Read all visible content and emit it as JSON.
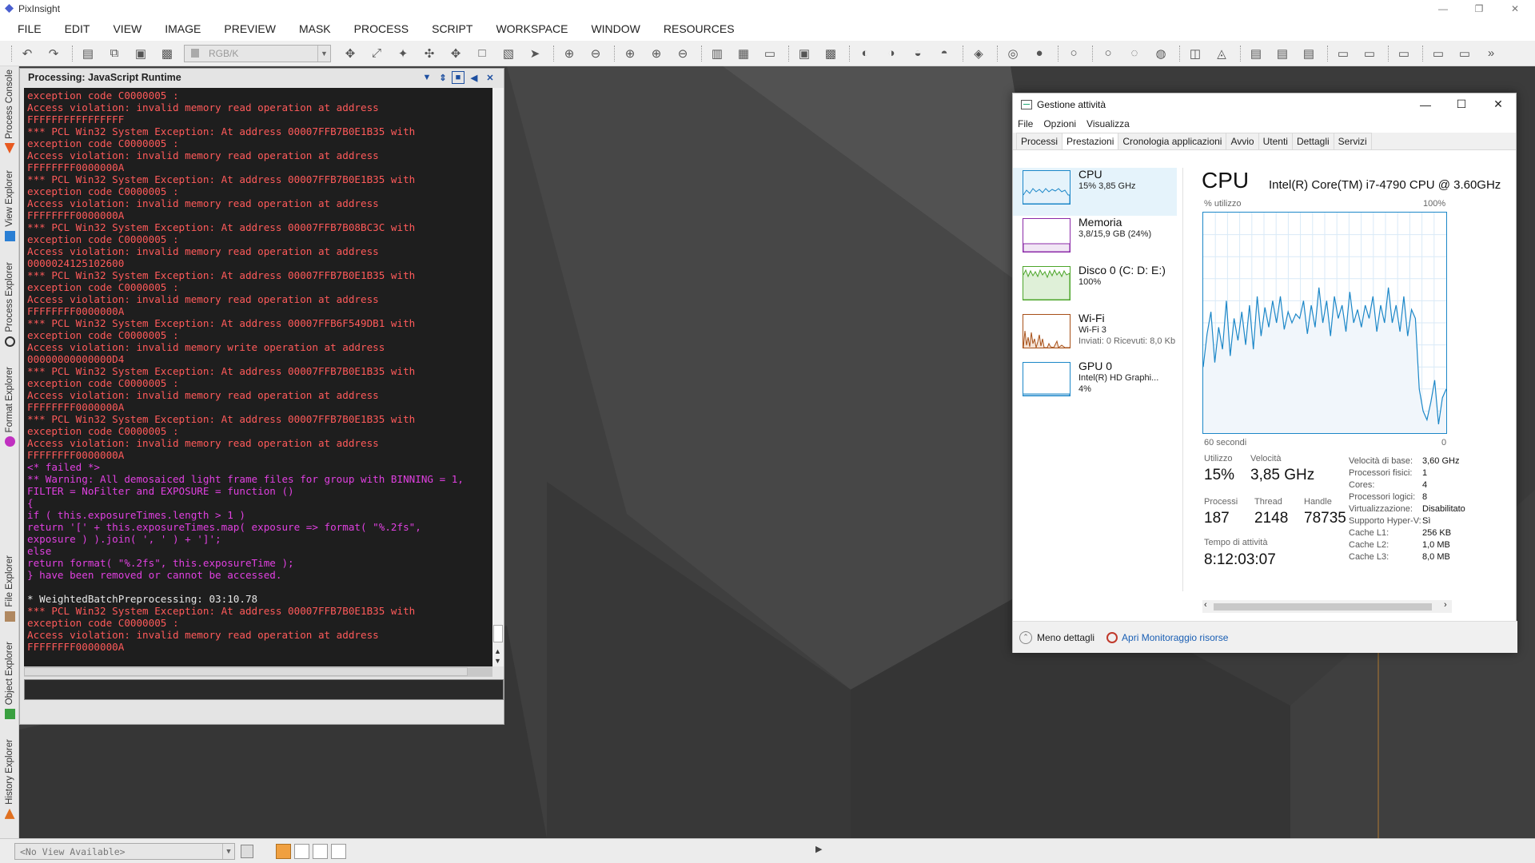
{
  "app": {
    "title": "PixInsight"
  },
  "menu": [
    "FILE",
    "EDIT",
    "VIEW",
    "IMAGE",
    "PREVIEW",
    "MASK",
    "PROCESS",
    "SCRIPT",
    "WORKSPACE",
    "WINDOW",
    "RESOURCES"
  ],
  "toolbar": {
    "color_space": "RGB/K"
  },
  "sidebar_tabs": [
    "Process Console",
    "View Explorer",
    "Process Explorer",
    "Format Explorer",
    "File Explorer",
    "Object Explorer",
    "History Explorer"
  ],
  "console": {
    "title": "Processing: JavaScript Runtime",
    "lines": [
      {
        "t": "exception code C0000005 :",
        "c": "#ff5a5a"
      },
      {
        "t": "Access violation: invalid memory read operation at address",
        "c": "#ff5a5a"
      },
      {
        "t": "FFFFFFFFFFFFFFFF",
        "c": "#ff5a5a"
      },
      {
        "t": "*** PCL Win32 System Exception: At address 00007FFB7B0E1B35 with",
        "c": "#ff5a5a"
      },
      {
        "t": "exception code C0000005 :",
        "c": "#ff5a5a"
      },
      {
        "t": "Access violation: invalid memory read operation at address",
        "c": "#ff5a5a"
      },
      {
        "t": "FFFFFFFF0000000A",
        "c": "#ff5a5a"
      },
      {
        "t": "*** PCL Win32 System Exception: At address 00007FFB7B0E1B35 with",
        "c": "#ff5a5a"
      },
      {
        "t": "exception code C0000005 :",
        "c": "#ff5a5a"
      },
      {
        "t": "Access violation: invalid memory read operation at address",
        "c": "#ff5a5a"
      },
      {
        "t": "FFFFFFFF0000000A",
        "c": "#ff5a5a"
      },
      {
        "t": "*** PCL Win32 System Exception: At address 00007FFB7B08BC3C with",
        "c": "#ff5a5a"
      },
      {
        "t": "exception code C0000005 :",
        "c": "#ff5a5a"
      },
      {
        "t": "Access violation: invalid memory read operation at address",
        "c": "#ff5a5a"
      },
      {
        "t": "0000024125102600",
        "c": "#ff5a5a"
      },
      {
        "t": "*** PCL Win32 System Exception: At address 00007FFB7B0E1B35 with",
        "c": "#ff5a5a"
      },
      {
        "t": "exception code C0000005 :",
        "c": "#ff5a5a"
      },
      {
        "t": "Access violation: invalid memory read operation at address",
        "c": "#ff5a5a"
      },
      {
        "t": "FFFFFFFF0000000A",
        "c": "#ff5a5a"
      },
      {
        "t": "*** PCL Win32 System Exception: At address 00007FFB6F549DB1 with",
        "c": "#ff5a5a"
      },
      {
        "t": "exception code C0000005 :",
        "c": "#ff5a5a"
      },
      {
        "t": "Access violation: invalid memory write operation at address",
        "c": "#ff5a5a"
      },
      {
        "t": "00000000000000D4",
        "c": "#ff5a5a"
      },
      {
        "t": "*** PCL Win32 System Exception: At address 00007FFB7B0E1B35 with",
        "c": "#ff5a5a"
      },
      {
        "t": "exception code C0000005 :",
        "c": "#ff5a5a"
      },
      {
        "t": "Access violation: invalid memory read operation at address",
        "c": "#ff5a5a"
      },
      {
        "t": "FFFFFFFF0000000A",
        "c": "#ff5a5a"
      },
      {
        "t": "*** PCL Win32 System Exception: At address 00007FFB7B0E1B35 with",
        "c": "#ff5a5a"
      },
      {
        "t": "exception code C0000005 :",
        "c": "#ff5a5a"
      },
      {
        "t": "Access violation: invalid memory read operation at address",
        "c": "#ff5a5a"
      },
      {
        "t": "FFFFFFFF0000000A",
        "c": "#ff5a5a"
      },
      {
        "t": "<* failed *>",
        "c": "#e040e0"
      },
      {
        "t": "** Warning: All demosaiced light frame files for group with BINNING = 1,",
        "c": "#e040e0"
      },
      {
        "t": "FILTER = NoFilter and EXPOSURE = function ()",
        "c": "#e040e0"
      },
      {
        "t": "{",
        "c": "#e040e0"
      },
      {
        "t": "if ( this.exposureTimes.length > 1 )",
        "c": "#e040e0"
      },
      {
        "t": "return '[' + this.exposureTimes.map( exposure => format( \"%.2fs\",",
        "c": "#e040e0"
      },
      {
        "t": "exposure ) ).join( ', ' ) + ']';",
        "c": "#e040e0"
      },
      {
        "t": "else",
        "c": "#e040e0"
      },
      {
        "t": "return format( \"%.2fs\", this.exposureTime );",
        "c": "#e040e0"
      },
      {
        "t": "} have been removed or cannot be accessed.",
        "c": "#e040e0"
      },
      {
        "t": "",
        "c": "#e0e0e0"
      },
      {
        "t": "* WeightedBatchPreprocessing: 03:10.78",
        "c": "#e8e8e8"
      },
      {
        "t": "*** PCL Win32 System Exception: At address 00007FFB7B0E1B35 with",
        "c": "#ff5a5a"
      },
      {
        "t": "exception code C0000005 :",
        "c": "#ff5a5a"
      },
      {
        "t": "Access violation: invalid memory read operation at address",
        "c": "#ff5a5a"
      },
      {
        "t": "FFFFFFFF0000000A",
        "c": "#ff5a5a"
      }
    ]
  },
  "taskmanager": {
    "title": "Gestione attività",
    "menu": [
      "File",
      "Opzioni",
      "Visualizza"
    ],
    "tabs": [
      "Processi",
      "Prestazioni",
      "Cronologia applicazioni",
      "Avvio",
      "Utenti",
      "Dettagli",
      "Servizi"
    ],
    "active_tab": "Prestazioni",
    "resources": [
      {
        "name": "CPU",
        "sub1": "15% 3,85 GHz",
        "sub2": "",
        "color": "#1c87c8"
      },
      {
        "name": "Memoria",
        "sub1": "3,8/15,9 GB (24%)",
        "sub2": "",
        "color": "#8b2aa8"
      },
      {
        "name": "Disco 0 (C: D: E:)",
        "sub1": "100%",
        "sub2": "",
        "color": "#4ca52a"
      },
      {
        "name": "Wi-Fi",
        "sub1": "Wi-Fi 3",
        "sub2": "Inviati: 0 Ricevuti: 8,0 Kb",
        "color": "#a75018"
      },
      {
        "name": "GPU 0",
        "sub1": "Intel(R) HD Graphi...",
        "sub2": "4%",
        "color": "#1c87c8"
      }
    ],
    "cpu_title": "CPU",
    "cpu_model": "Intel(R) Core(TM) i7-4790 CPU @ 3.60GHz",
    "graph_label": "% utilizzo",
    "graph_max": "100%",
    "graph_time": "60 secondi",
    "graph_min": "0",
    "utilization_series": [
      30,
      45,
      55,
      32,
      48,
      38,
      60,
      35,
      52,
      42,
      55,
      40,
      58,
      38,
      62,
      44,
      57,
      48,
      60,
      50,
      62,
      47,
      55,
      50,
      54,
      52,
      60,
      45,
      58,
      48,
      66,
      50,
      60,
      44,
      62,
      52,
      58,
      46,
      64,
      50,
      56,
      48,
      58,
      52,
      62,
      46,
      58,
      50,
      66,
      50,
      58,
      46,
      62,
      44,
      56,
      52,
      20,
      10,
      6,
      14,
      24,
      4,
      16,
      20
    ],
    "stats": {
      "utilizzo_label": "Utilizzo",
      "utilizzo": "15%",
      "velocita_label": "Velocità",
      "velocita": "3,85 GHz",
      "processi_label": "Processi",
      "processi": "187",
      "thread_label": "Thread",
      "thread": "2148",
      "handle_label": "Handle",
      "handle": "78735",
      "tempo_label": "Tempo di attività",
      "tempo": "8:12:03:07"
    },
    "details": [
      {
        "k": "Velocità di base:",
        "v": "3,60 GHz"
      },
      {
        "k": "Processori fisici:",
        "v": "1"
      },
      {
        "k": "Cores:",
        "v": "4"
      },
      {
        "k": "Processori logici:",
        "v": "8"
      },
      {
        "k": "Virtualizzazione:",
        "v": "Disabilitato"
      },
      {
        "k": "Supporto Hyper-V:",
        "v": "Sì"
      },
      {
        "k": "Cache L1:",
        "v": "256 KB"
      },
      {
        "k": "Cache L2:",
        "v": "1,0 MB"
      },
      {
        "k": "Cache L3:",
        "v": "8,0 MB"
      }
    ],
    "footer_less": "Meno dettagli",
    "footer_monitor": "Apri Monitoraggio risorse"
  },
  "statusbar": {
    "view_placeholder": "<No View Available>"
  }
}
